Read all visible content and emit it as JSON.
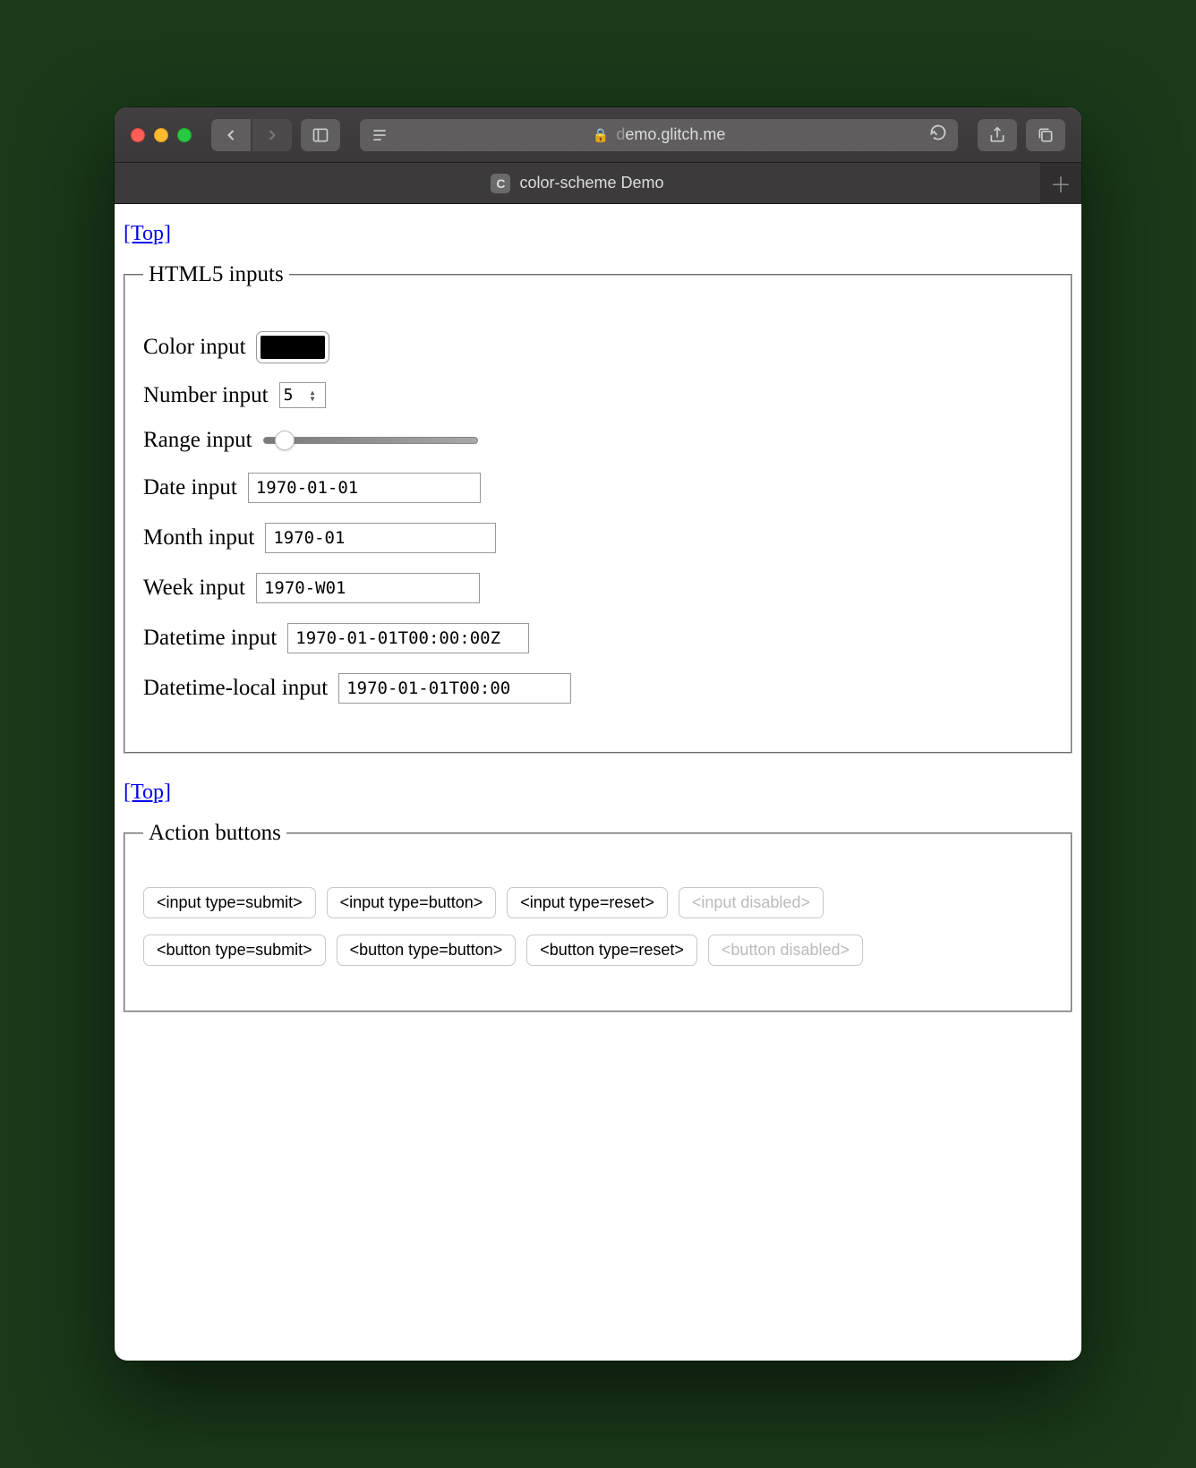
{
  "browser": {
    "url_host": "demo.glitch.me",
    "url_prefix": "d",
    "tab_title": "color-scheme Demo",
    "favicon_letter": "C"
  },
  "links": {
    "top": "[Top]"
  },
  "fieldsets": {
    "html5": {
      "legend": "HTML5 inputs",
      "color_label": "Color input",
      "color_value": "#000000",
      "number_label": "Number input",
      "number_value": "5",
      "range_label": "Range input",
      "range_value": 10,
      "date_label": "Date input",
      "date_value": "1970-01-01",
      "month_label": "Month input",
      "month_value": "1970-01",
      "week_label": "Week input",
      "week_value": "1970-W01",
      "datetime_label": "Datetime input",
      "datetime_value": "1970-01-01T00:00:00Z",
      "datetime_local_label": "Datetime-local input",
      "datetime_local_value": "1970-01-01T00:00"
    },
    "actions": {
      "legend": "Action buttons",
      "input_submit": "<input type=submit>",
      "input_button": "<input type=button>",
      "input_reset": "<input type=reset>",
      "input_disabled": "<input disabled>",
      "button_submit": "<button type=submit>",
      "button_button": "<button type=button>",
      "button_reset": "<button type=reset>",
      "button_disabled": "<button disabled>"
    }
  }
}
